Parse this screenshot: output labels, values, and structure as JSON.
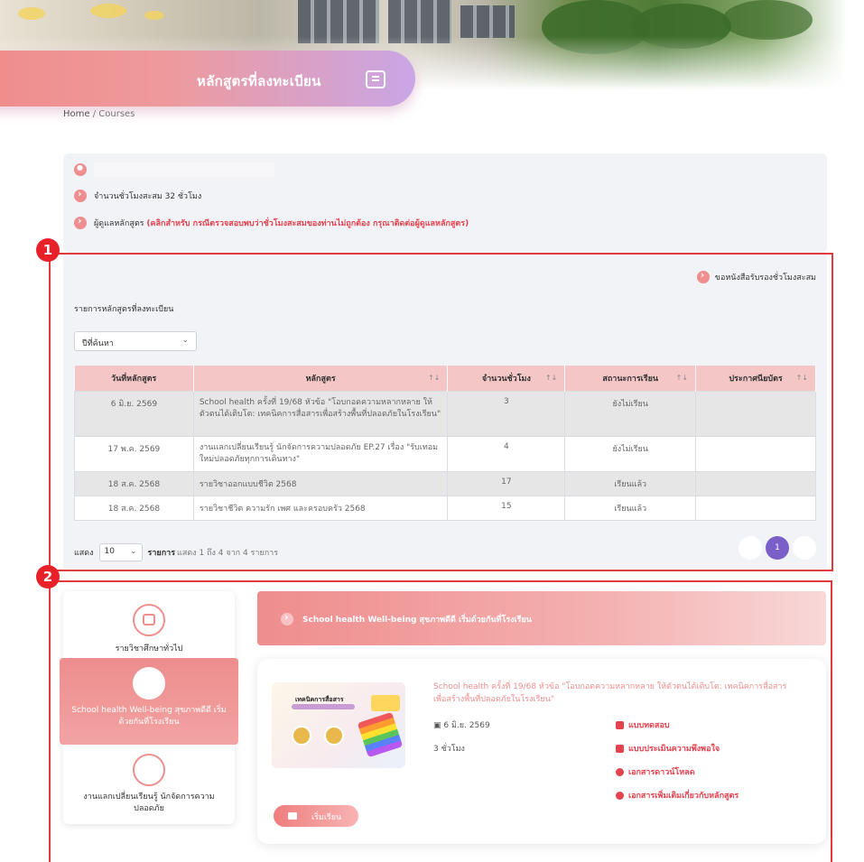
{
  "header": {
    "title": "หลักสูตรที่ลงทะเบียน"
  },
  "breadcrumb": {
    "home": "Home",
    "separator": "/",
    "current": "Courses"
  },
  "info": {
    "user_name": "",
    "hours_label": "จำนวนชั่วโมงสะสม 32 ชั่วโมง",
    "admin_label": "ผู้ดูแลหลักสูตร",
    "admin_note": "(คลิกสำหรับ กรณีตรวจสอบพบว่าชั่วโมงสะสมของท่านไม่ถูกต้อง กรุณาติดต่อผู้ดูแลหลักสูตร)"
  },
  "annotations": {
    "section1": "1",
    "section2": "2"
  },
  "registered": {
    "certificate_button": "ขอหนังสือรับรองชั่วโมงสะสม",
    "list_title": "รายการหลักสูตรที่ลงทะเบียน",
    "year_select": "ปีที่ค้นหา",
    "columns": [
      "วันที่หลักสูตร",
      "หลักสูตร",
      "จำนวนชั่วโมง",
      "สถานะการเรียน",
      "ประกาศนียบัตร"
    ],
    "rows": [
      {
        "date": "6 มิ.ย. 2569",
        "course": "School health ครั้งที่ 19/68 หัวข้อ \"โอบกอดความหลากหลาย ให้ตัวตนได้เติบโต: เทคนิคการสื่อสารเพื่อสร้างพื้นที่ปลอดภัยในโรงเรียน\"",
        "hours": "3",
        "status": "ยังไม่เรียน",
        "certificate": ""
      },
      {
        "date": "17 พ.ค. 2569",
        "course": "งานแลกเปลี่ยนเรียนรู้ นักจัดการความปลอดภัย EP.27 เรื่อง \"รับเทอมใหม่ปลอดภัยทุกการเดินทาง\"",
        "hours": "4",
        "status": "ยังไม่เรียน",
        "certificate": ""
      },
      {
        "date": "18 ส.ค. 2568",
        "course": "รายวิชาออกแบบชีวิต 2568",
        "hours": "17",
        "status": "เรียนแล้ว",
        "certificate": ""
      },
      {
        "date": "18 ส.ค. 2568",
        "course": "รายวิชาชีวิต ความรัก เพศ และครอบครัว 2568",
        "hours": "15",
        "status": "เรียนแล้ว",
        "certificate": ""
      }
    ],
    "length_prefix": "แสดง",
    "length_value": "10",
    "length_suffix": "รายการ",
    "info_text": "แสดง 1 ถึง 4 จาก 4 รายการ",
    "current_page": "1"
  },
  "categories": {
    "items": [
      {
        "label": "รายวิชาศึกษาทั่วไป"
      },
      {
        "label": "School health Well-being สุขภาพดีดี เริ่มด้วยกันที่โรงเรียน"
      },
      {
        "label": "งานแลกเปลี่ยนเรียนรู้ นักจัดการความปลอดภัย"
      }
    ],
    "banner_title": "School health Well-being สุขภาพดีดี เริ่มด้วยกันที่โรงเรียน"
  },
  "course_card": {
    "title": "School health ครั้งที่ 19/68 หัวข้อ \"โอบกอดความหลากหลาย ให้ตัวตนได้เติบโต: เทคนิคการสื่อสารเพื่อสร้างพื้นที่ปลอดภัยในโรงเรียน\"",
    "thumb_title": "เทคนิคการสื่อสาร",
    "date": "6 มิ.ย. 2569",
    "hours": "3 ชั่วโมง",
    "links": [
      "แบบทดสอบ",
      "แบบประเมินความพึงพอใจ",
      "เอกสารดาวน์โหลด",
      "เอกสารเพิ่มเติมเกี่ยวกับหลักสูตร"
    ],
    "start_button": "เริ่มเรียน"
  }
}
